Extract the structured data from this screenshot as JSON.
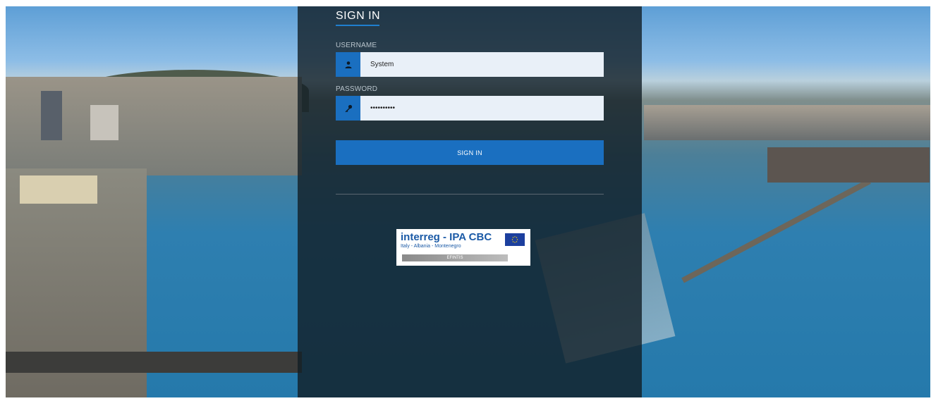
{
  "signin": {
    "title": "SIGN IN",
    "username_label": "USERNAME",
    "username_value": "System",
    "password_label": "PASSWORD",
    "password_value": "••••••••••",
    "button_label": "SIGN IN"
  },
  "logo": {
    "brand": "interreg - IPA CBC",
    "subtitle": "Italy - Albania - Montenegro",
    "project": "EFINTIS"
  },
  "icons": {
    "username": "user-icon",
    "password": "key-icon",
    "eu_flag": "eu-flag-icon"
  },
  "colors": {
    "accent": "#1a6fc0",
    "overlay": "#121e26",
    "input_bg": "#e9f0f8"
  }
}
